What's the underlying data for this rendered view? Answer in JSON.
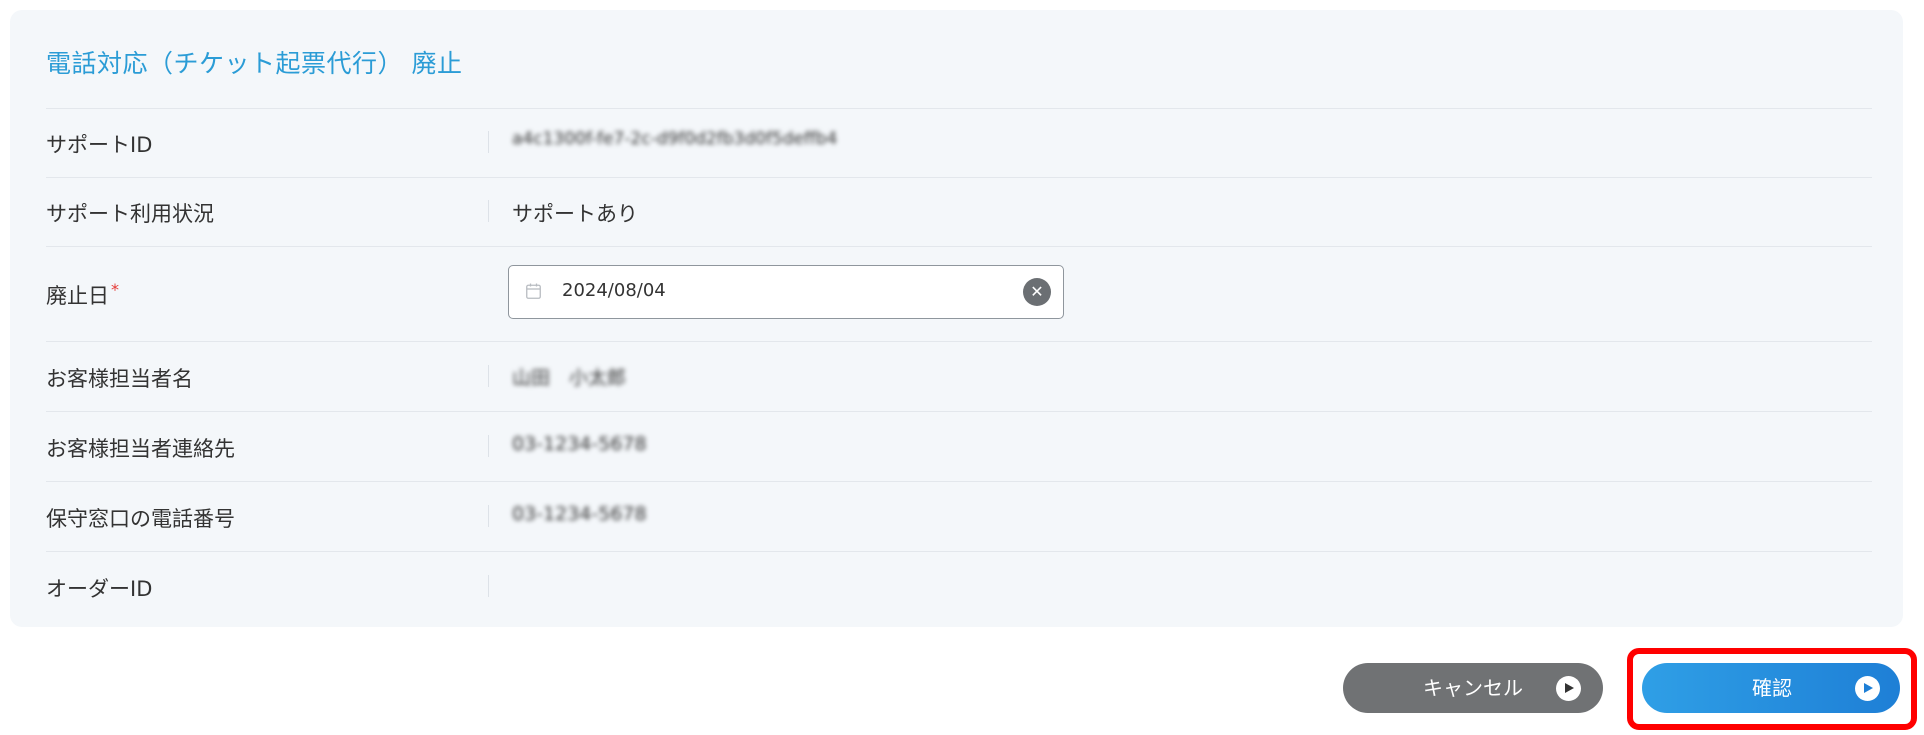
{
  "form": {
    "title": "電話対応（チケット起票代行） 廃止",
    "rows": [
      {
        "label": "サポートID",
        "value": "a4c1300f-fe7-2c-d9f0d2fb3d0f5deffb4"
      },
      {
        "label": "サポート利用状況",
        "value": "サポートあり"
      },
      {
        "label": "廃止日",
        "required_mark": "*",
        "input_value": "2024/08/04"
      },
      {
        "label": "お客様担当者名",
        "value": "山田　小太郎"
      },
      {
        "label": "お客様担当者連絡先",
        "value": "03-1234-5678"
      },
      {
        "label": "保守窓口の電話番号",
        "value": "03-1234-5678"
      },
      {
        "label": "オーダーID",
        "value": ""
      }
    ]
  },
  "buttons": {
    "cancel_label": "キャンセル",
    "confirm_label": "確認"
  },
  "icons": {
    "calendar": "calendar-icon",
    "clear": "clear-icon",
    "play": "play-circle-icon"
  },
  "colors": {
    "title": "#2b9cd6",
    "required": "#e53935",
    "cancel_button": "#707274",
    "confirm_button": "#1e7fd6",
    "highlight": "#ff0000"
  }
}
